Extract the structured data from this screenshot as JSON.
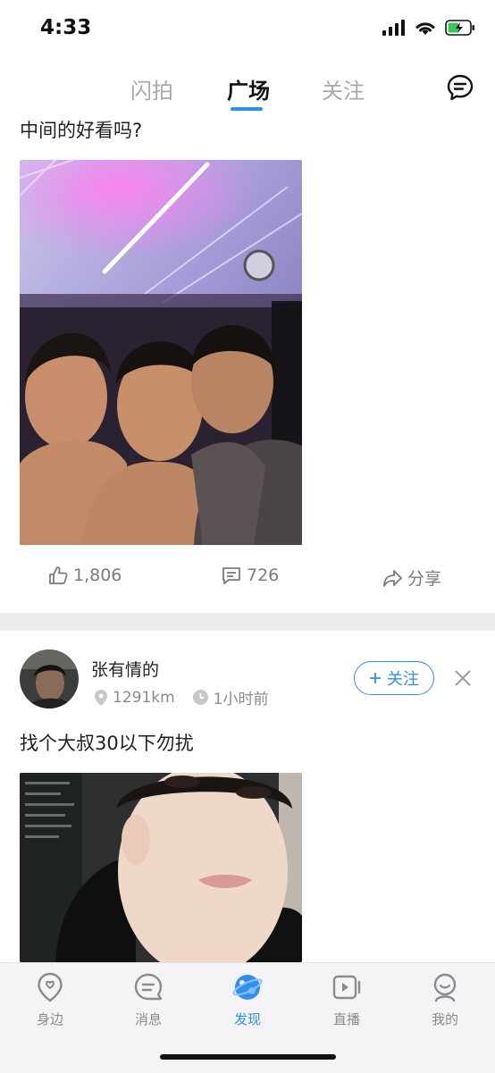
{
  "status_bar": {
    "time": "4:33"
  },
  "nav": {
    "tabs": [
      {
        "label": "闪拍"
      },
      {
        "label": "广场"
      },
      {
        "label": "关注"
      }
    ],
    "active_tab": "广场"
  },
  "post1": {
    "text": "中间的好看吗?",
    "likes": "1,806",
    "comments": "726",
    "share_label": "分享"
  },
  "post2": {
    "username": "张有情的",
    "distance": "1291km",
    "time": "1小时前",
    "follow_label": "关注",
    "text": "找个大叔30以下勿扰"
  },
  "tabbar": {
    "items": [
      {
        "label": "身边",
        "icon": "location-icon"
      },
      {
        "label": "消息",
        "icon": "message-icon"
      },
      {
        "label": "发现",
        "icon": "planet-icon"
      },
      {
        "label": "直播",
        "icon": "live-icon"
      },
      {
        "label": "我的",
        "icon": "profile-icon"
      }
    ],
    "active": "发现"
  },
  "colors": {
    "accent": "#2e8ff0",
    "inactive": "#8a8a90",
    "divider": "#ececef"
  }
}
